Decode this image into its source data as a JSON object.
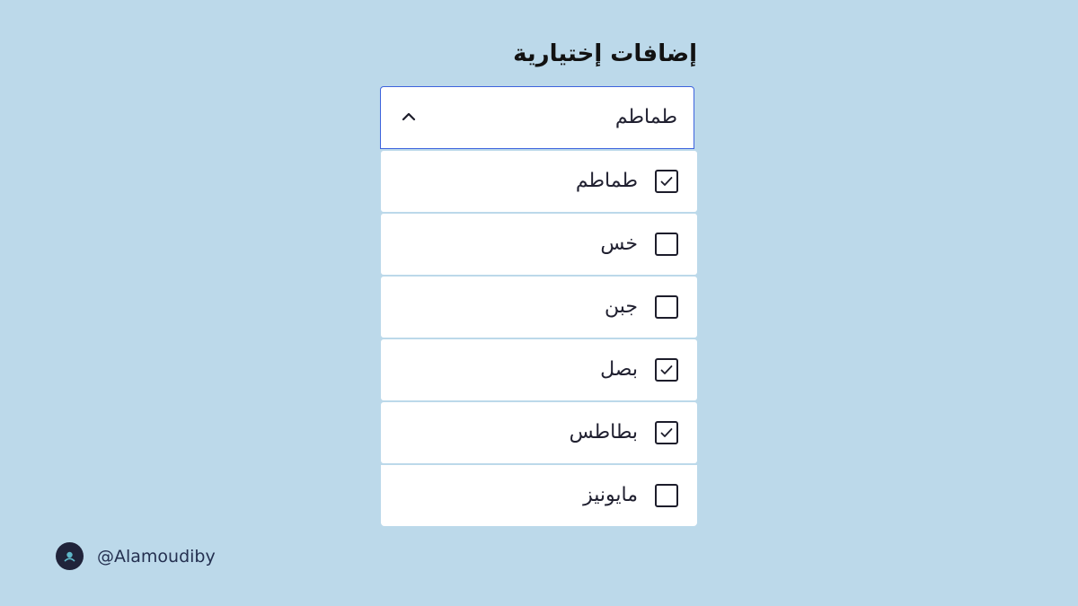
{
  "field": {
    "label": "إضافات إختيارية",
    "selected_value": "طماطم",
    "expanded": true,
    "chevron_icon": "chevron-up-icon"
  },
  "options": [
    {
      "label": "طماطم",
      "checked": true
    },
    {
      "label": "خس",
      "checked": false
    },
    {
      "label": "جبن",
      "checked": false
    },
    {
      "label": "بصل",
      "checked": true
    },
    {
      "label": "بطاطس",
      "checked": true
    },
    {
      "label": "مايونيز",
      "checked": false
    }
  ],
  "footer": {
    "avatar_icon": "avatar-icon",
    "handle": "@Alamoudiby"
  },
  "colors": {
    "background": "#bcd9ea",
    "focus_border": "#3d63dd",
    "text": "#202030"
  }
}
